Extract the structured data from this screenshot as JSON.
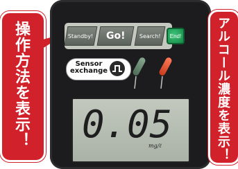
{
  "callouts": {
    "left": "操作方法を表示！",
    "right": "アルコール濃度を表示！"
  },
  "buttons": {
    "standby": "Standby!",
    "go": "Go!",
    "search": "Search!",
    "end": "End!"
  },
  "sensor": {
    "label_line1": "Sensor",
    "label_line2": "exchange"
  },
  "display": {
    "reading": "0.05",
    "unit": "mg/ℓ"
  },
  "colors": {
    "callout": "#d1212a",
    "device": "#1c1c1e",
    "end_button": "#138a45",
    "lamp_red": "#e3502e",
    "lamp_green": "#6c8a72"
  },
  "icons": [
    "sensor-exchange-icon",
    "green-lamp-icon",
    "red-lamp-icon"
  ]
}
